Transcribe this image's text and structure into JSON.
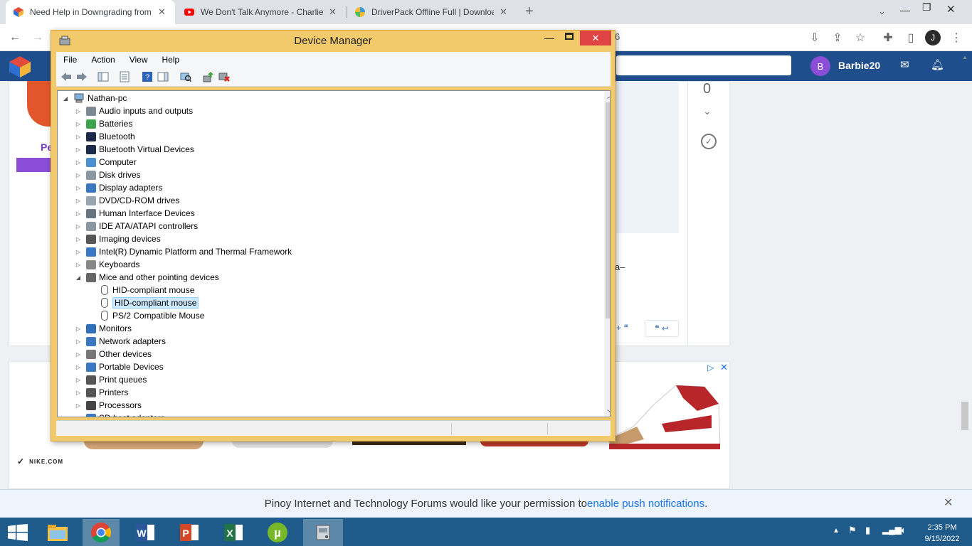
{
  "browser": {
    "tabs": [
      {
        "title": "Need Help in Downgrading from",
        "icon": "pinoy-forum-icon"
      },
      {
        "title": "We Don't Talk Anymore - Charlie",
        "icon": "youtube-icon"
      },
      {
        "title": "DriverPack Offline Full | Downloa",
        "icon": "driverpack-icon"
      }
    ],
    "new_tab": "+",
    "profile_initial": "J",
    "url_fragment": "6"
  },
  "forum": {
    "user_initial": "B",
    "username": "Barbie20",
    "vote_count": "0",
    "partial_name": "Pe",
    "partial_text": "a–",
    "ad_brand": "NIKE.COM"
  },
  "device_manager": {
    "title": "Device Manager",
    "menu": [
      "File",
      "Action",
      "View",
      "Help"
    ],
    "root": "Nathan-pc",
    "categories": [
      {
        "label": "Audio inputs and outputs",
        "icon": "speaker-icon"
      },
      {
        "label": "Batteries",
        "icon": "battery-icon"
      },
      {
        "label": "Bluetooth",
        "icon": "bluetooth-icon"
      },
      {
        "label": "Bluetooth Virtual Devices",
        "icon": "bluetooth-icon"
      },
      {
        "label": "Computer",
        "icon": "computer-icon"
      },
      {
        "label": "Disk drives",
        "icon": "disk-icon"
      },
      {
        "label": "Display adapters",
        "icon": "display-icon"
      },
      {
        "label": "DVD/CD-ROM drives",
        "icon": "dvd-icon"
      },
      {
        "label": "Human Interface Devices",
        "icon": "hid-icon"
      },
      {
        "label": "IDE ATA/ATAPI controllers",
        "icon": "ide-icon"
      },
      {
        "label": "Imaging devices",
        "icon": "camera-icon"
      },
      {
        "label": "Intel(R) Dynamic Platform and Thermal Framework",
        "icon": "chip-icon"
      },
      {
        "label": "Keyboards",
        "icon": "keyboard-icon"
      },
      {
        "label": "Mice and other pointing devices",
        "icon": "mouse-icon",
        "expanded": true,
        "children": [
          "HID-compliant mouse",
          "HID-compliant mouse",
          "PS/2 Compatible Mouse"
        ],
        "selected_child": 1
      },
      {
        "label": "Monitors",
        "icon": "monitor-icon"
      },
      {
        "label": "Network adapters",
        "icon": "network-icon"
      },
      {
        "label": "Other devices",
        "icon": "unknown-device-icon"
      },
      {
        "label": "Portable Devices",
        "icon": "portable-icon"
      },
      {
        "label": "Print queues",
        "icon": "printer-icon"
      },
      {
        "label": "Printers",
        "icon": "printer-icon"
      },
      {
        "label": "Processors",
        "icon": "cpu-icon"
      },
      {
        "label": "SD host adapters",
        "icon": "sd-icon"
      }
    ]
  },
  "notification": {
    "text": "Pinoy Internet and Technology Forums would like your permission to ",
    "link": "enable push notifications",
    "suffix": "."
  },
  "taskbar": {
    "apps": [
      "file-explorer-icon",
      "chrome-icon",
      "word-icon",
      "powerpoint-icon",
      "excel-icon",
      "utorrent-icon",
      "device-manager-icon"
    ],
    "time": "2:35 PM",
    "date": "9/15/2022"
  },
  "colors": {
    "forum_nav": "#1f4e8c",
    "titlebar": "#f2c96b",
    "taskbar": "#1e5a8a",
    "close": "#e04343"
  }
}
